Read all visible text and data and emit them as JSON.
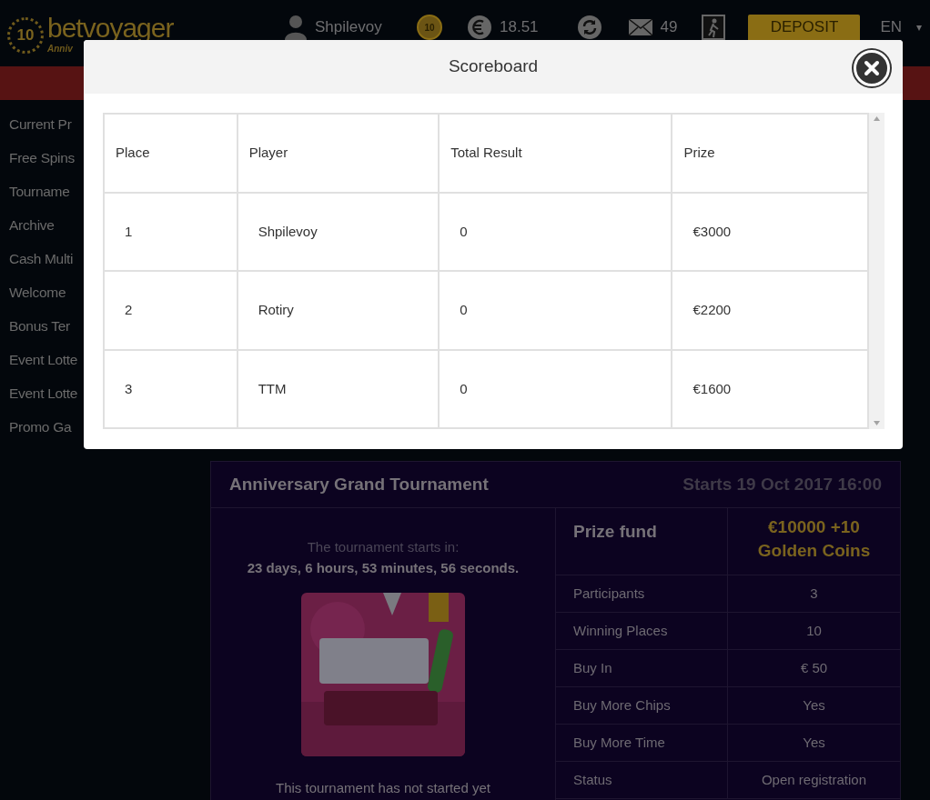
{
  "header": {
    "logo_badge": "10",
    "logo_text": "betvoyager",
    "logo_tagline": "Anniv",
    "user": "Shpilevoy",
    "coin_badge": "10",
    "balance": "18.51",
    "messages": "49",
    "deposit": "DEPOSIT",
    "language": "EN",
    "language_caret": "▾"
  },
  "sidebar": {
    "items": [
      "Current Pr",
      "Free Spins",
      "Tourname",
      "Archive",
      "Cash Multi",
      "Welcome",
      "Bonus Ter",
      "Event Lotte",
      "Event Lotte",
      "Promo Ga"
    ]
  },
  "tournament": {
    "title": "Anniversary Grand Tournament",
    "starts": "Starts 19 Oct 2017 16:00",
    "countdown_label": "The tournament starts in:",
    "countdown": "23 days, 6 hours, 53 minutes, 56 seconds.",
    "caption": "This tournament has not started yet",
    "prize": {
      "label": "Prize fund",
      "value": "€10000 +10 Golden Coins"
    },
    "details": [
      {
        "label": "Participants",
        "value": "3"
      },
      {
        "label": "Winning Places",
        "value": "10"
      },
      {
        "label": "Buy In",
        "value": "€ 50"
      },
      {
        "label": "Buy More Chips",
        "value": "Yes"
      },
      {
        "label": "Buy More Time",
        "value": "Yes"
      },
      {
        "label": "Status",
        "value": "Open registration"
      }
    ]
  },
  "modal": {
    "title": "Scoreboard",
    "columns": [
      "Place",
      "Player",
      "Total Result",
      "Prize"
    ],
    "rows": [
      [
        "1",
        "Shpilevoy",
        "0",
        "€3000"
      ],
      [
        "2",
        "Rotiry",
        "0",
        "€2200"
      ],
      [
        "3",
        "TTM",
        "0",
        "€1600"
      ]
    ]
  }
}
